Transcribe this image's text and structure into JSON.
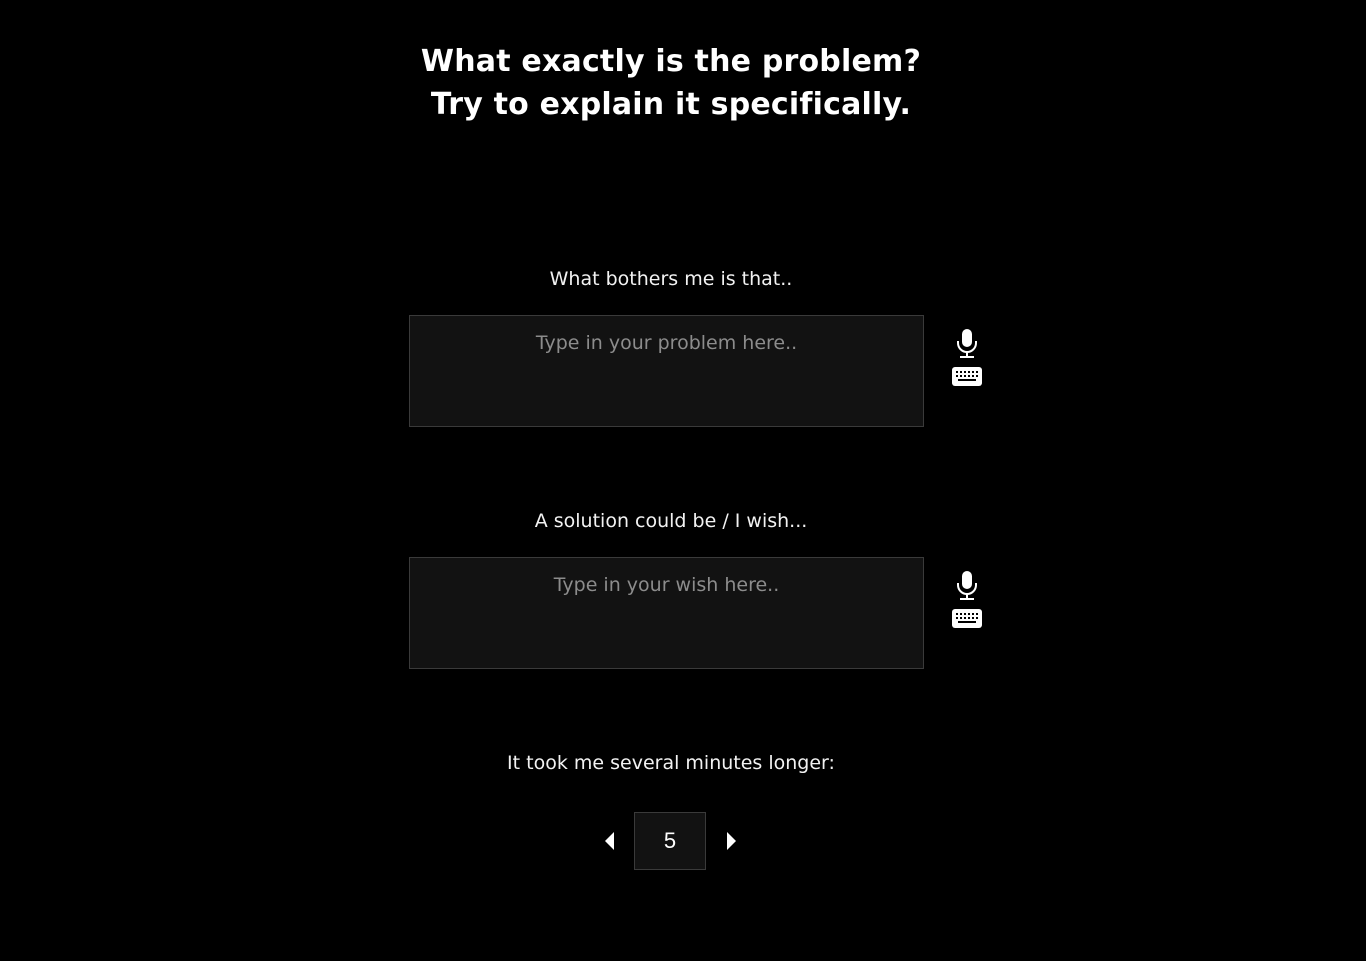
{
  "heading": {
    "line1": "What exactly is the problem?",
    "line2": "Try to explain it specifically."
  },
  "problem": {
    "label": "What bothers me is that..",
    "value": "",
    "placeholder": "Type in your problem here..",
    "mic_icon": "microphone-icon",
    "keyboard_icon": "keyboard-icon"
  },
  "wish": {
    "label": "A solution could be / I wish...",
    "value": "",
    "placeholder": "Type in your wish here..",
    "mic_icon": "microphone-icon",
    "keyboard_icon": "keyboard-icon"
  },
  "duration": {
    "label": "It took me several minutes longer:",
    "value": "5",
    "decrement_icon": "caret-left-icon",
    "increment_icon": "caret-right-icon"
  },
  "colors": {
    "background": "#000000",
    "input_background": "#121212",
    "text": "#ffffff",
    "placeholder": "#8c8c8c"
  }
}
